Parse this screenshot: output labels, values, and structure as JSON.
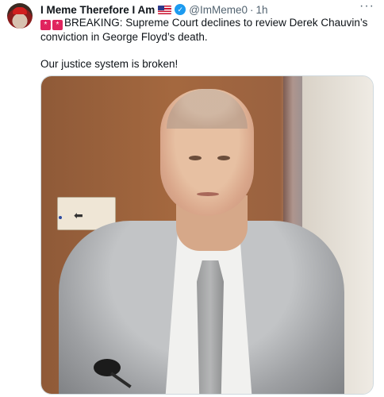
{
  "author": {
    "display_name": "I Meme Therefore I Am",
    "handle": "@ImMeme0",
    "time_ago": "1h",
    "separator": "·",
    "flag_icon": "us-flag-icon",
    "verified_icon": "verified-badge-icon"
  },
  "menu": {
    "more_label": "···"
  },
  "tweet": {
    "emoji_icon": "rotating-light-emoji",
    "lines": [
      "BREAKING: Supreme Court declines to review Derek Chauvin’s conviction in George Floyd’s death.",
      "Our justice system is broken!"
    ]
  },
  "media": {
    "type": "photo",
    "sign_symbol": "⬅"
  },
  "colors": {
    "verified": "#1d9bf0",
    "text_primary": "#0f1419",
    "text_secondary": "#536471",
    "border": "#cfd9de"
  }
}
